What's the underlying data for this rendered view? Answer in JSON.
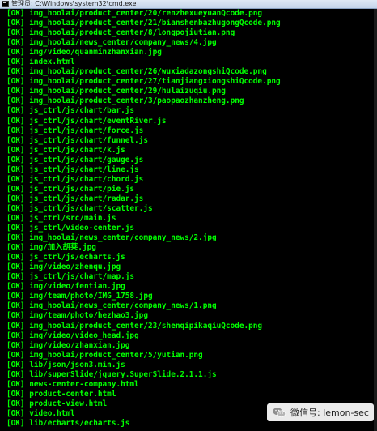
{
  "window": {
    "title": "管理员: C:\\Windows\\system32\\cmd.exe"
  },
  "console": {
    "lines": [
      "[OK] img_hoolai/product_center/20/renzhexueyuanQcode.png",
      "[OK] img_hoolai/product_center/21/bianshenbazhugongQcode.png",
      "[OK] img_hoolai/product_center/8/longpojiutian.png",
      "[OK] img_hoolai/news_center/company_news/4.jpg",
      "[OK] img/video/quanminzhanxian.jpg",
      "[OK] index.html",
      "[OK] img_hoolai/product_center/26/wuxiadazongshiQcode.png",
      "[OK] img_hoolai/product_center/27/tianjiangxiongshiQcode.png",
      "[OK] img_hoolai/product_center/29/hulaizuqiu.png",
      "[OK] img_hoolai/product_center/3/paopaozhanzheng.png",
      "[OK] js_ctrl/js/chart/bar.js",
      "[OK] js_ctrl/js/chart/eventRiver.js",
      "[OK] js_ctrl/js/chart/force.js",
      "[OK] js_ctrl/js/chart/funnel.js",
      "[OK] js_ctrl/js/chart/k.js",
      "[OK] js_ctrl/js/chart/gauge.js",
      "[OK] js_ctrl/js/chart/line.js",
      "[OK] js_ctrl/js/chart/chord.js",
      "[OK] js_ctrl/js/chart/pie.js",
      "[OK] js_ctrl/js/chart/radar.js",
      "[OK] js_ctrl/js/chart/scatter.js",
      "[OK] js_ctrl/src/main.js",
      "[OK] js_ctrl/video-center.js",
      "[OK] img_hoolai/news_center/company_news/2.jpg",
      "[OK] img/加入胡莱.jpg",
      "[OK] js_ctrl/js/echarts.js",
      "[OK] img/video/zhenqu.jpg",
      "[OK] js_ctrl/js/chart/map.js",
      "[OK] img/video/fentian.jpg",
      "[OK] img/team/photo/IMG_1758.jpg",
      "[OK] img_hoolai/news_center/company_news/1.png",
      "[OK] img/team/photo/hezhao3.jpg",
      "[OK] img_hoolai/product_center/23/shenqipikaqiuQcode.png",
      "[OK] img/video/video_head.jpg",
      "[OK] img/video/zhanxian.jpg",
      "[OK] img_hoolai/product_center/5/yutian.png",
      "[OK] lib/json/json3.min.js",
      "[OK] lib/superSlide/jquery.SuperSlide.2.1.1.js",
      "[OK] news-center-company.html",
      "[OK] product-center.html",
      "[OK] product-view.html",
      "[OK] video.html",
      "[OK] lib/echarts/echarts.js"
    ]
  },
  "watermark": {
    "text": "微信号: lemon-sec",
    "icon": "wechat-icon"
  }
}
